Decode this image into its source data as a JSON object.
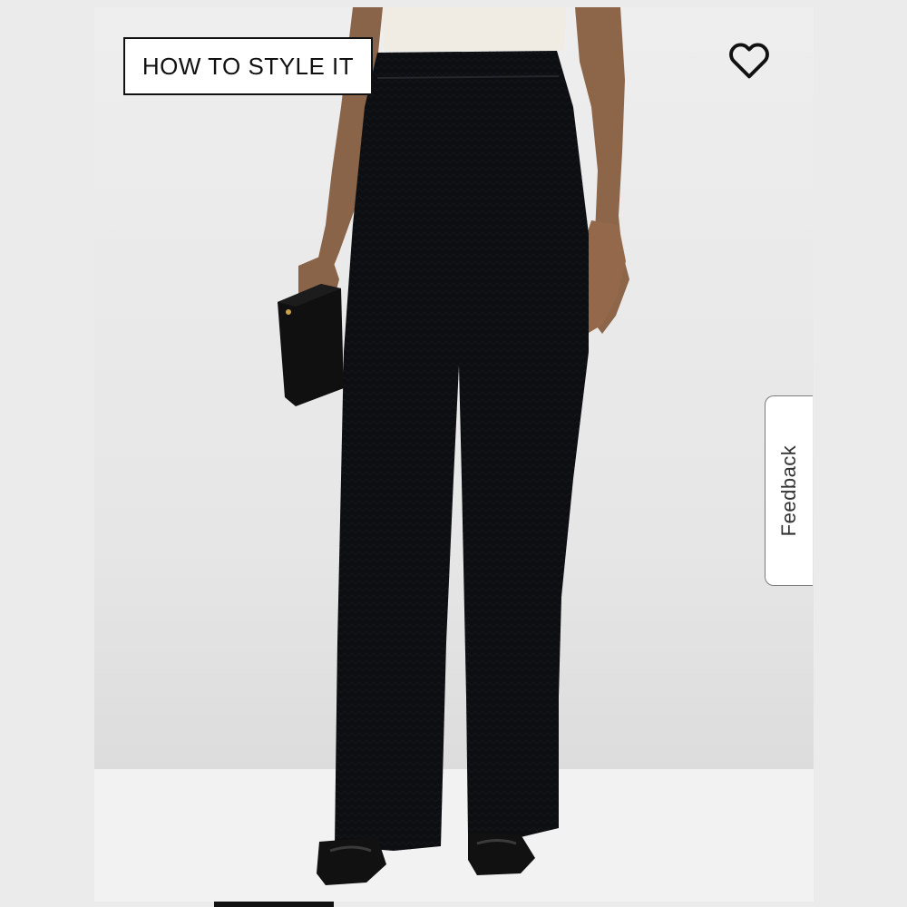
{
  "product_image": {
    "description_icon": "pants-photo",
    "style_button_label": "HOW TO STYLE IT",
    "wishlist_icon": "heart-icon",
    "feedback_label": "Feedback"
  },
  "colors": {
    "background": "#ebebeb",
    "button_border": "#111111",
    "garment": "#0d0e12"
  }
}
